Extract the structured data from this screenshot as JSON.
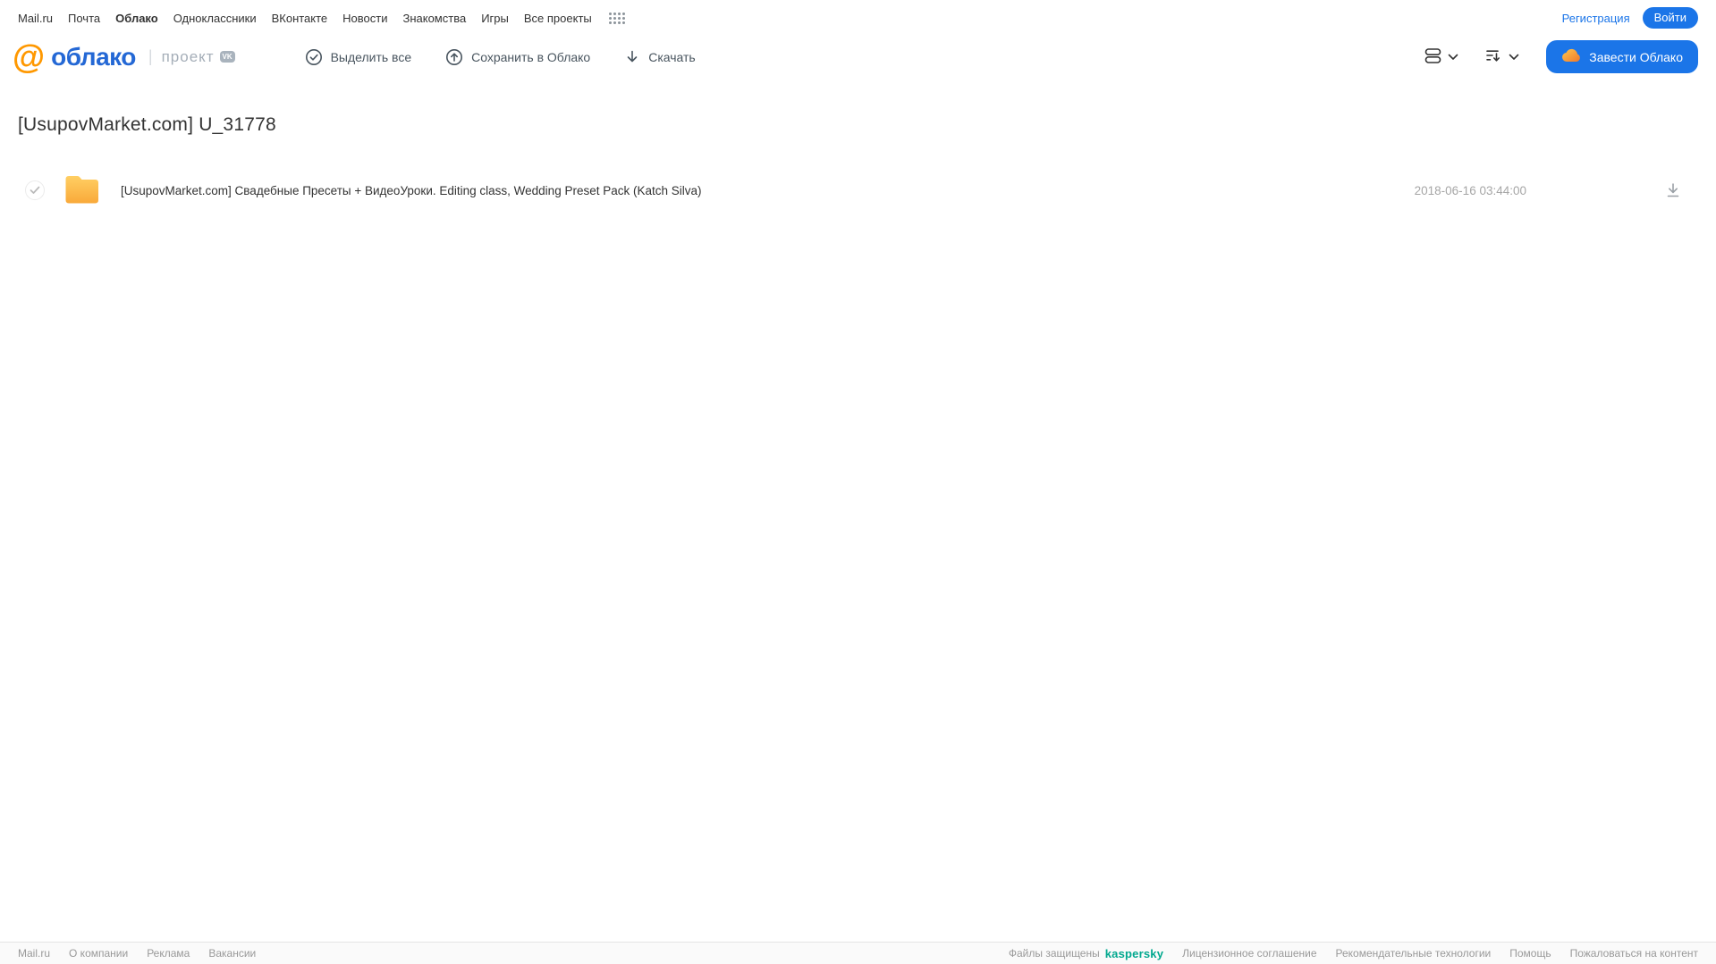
{
  "topnav": {
    "items": [
      {
        "label": "Mail.ru"
      },
      {
        "label": "Почта"
      },
      {
        "label": "Облако",
        "active": true
      },
      {
        "label": "Одноклассники"
      },
      {
        "label": "ВКонтакте"
      },
      {
        "label": "Новости"
      },
      {
        "label": "Знакомства"
      },
      {
        "label": "Игры"
      },
      {
        "label": "Все проекты"
      }
    ],
    "registration_label": "Регистрация",
    "login_label": "Войти"
  },
  "header": {
    "logo_at": "@",
    "logo_text": "облако",
    "project_label": "проект",
    "vk_badge": "VK",
    "toolbar": {
      "select_all_label": "Выделить все",
      "save_label": "Сохранить в Облако",
      "download_label": "Скачать"
    },
    "create_cloud_label": "Завести Облако"
  },
  "main": {
    "title": "[UsupovMarket.com] U_31778",
    "files": [
      {
        "type": "folder",
        "name": "[UsupovMarket.com] Свадебные Пресеты + ВидеоУроки. Editing class, Wedding Preset Pack (Katch Silva)",
        "date": "2018-06-16 03:44:00"
      }
    ]
  },
  "footer": {
    "left_links": [
      {
        "label": "Mail.ru"
      },
      {
        "label": "О компании"
      },
      {
        "label": "Реклама"
      },
      {
        "label": "Вакансии"
      }
    ],
    "protected_text": "Файлы защищены",
    "kaspersky_label": "kaspersky",
    "right_links": [
      {
        "label": "Лицензионное соглашение"
      },
      {
        "label": "Рекомендательные технологии"
      },
      {
        "label": "Помощь"
      },
      {
        "label": "Пожаловаться на контент"
      }
    ]
  },
  "colors": {
    "accent_blue": "#1b75e8",
    "logo_blue": "#2468d5",
    "logo_orange": "#ff9800",
    "folder_yellow": "#fbb03b",
    "kaspersky_green": "#00a88e"
  }
}
